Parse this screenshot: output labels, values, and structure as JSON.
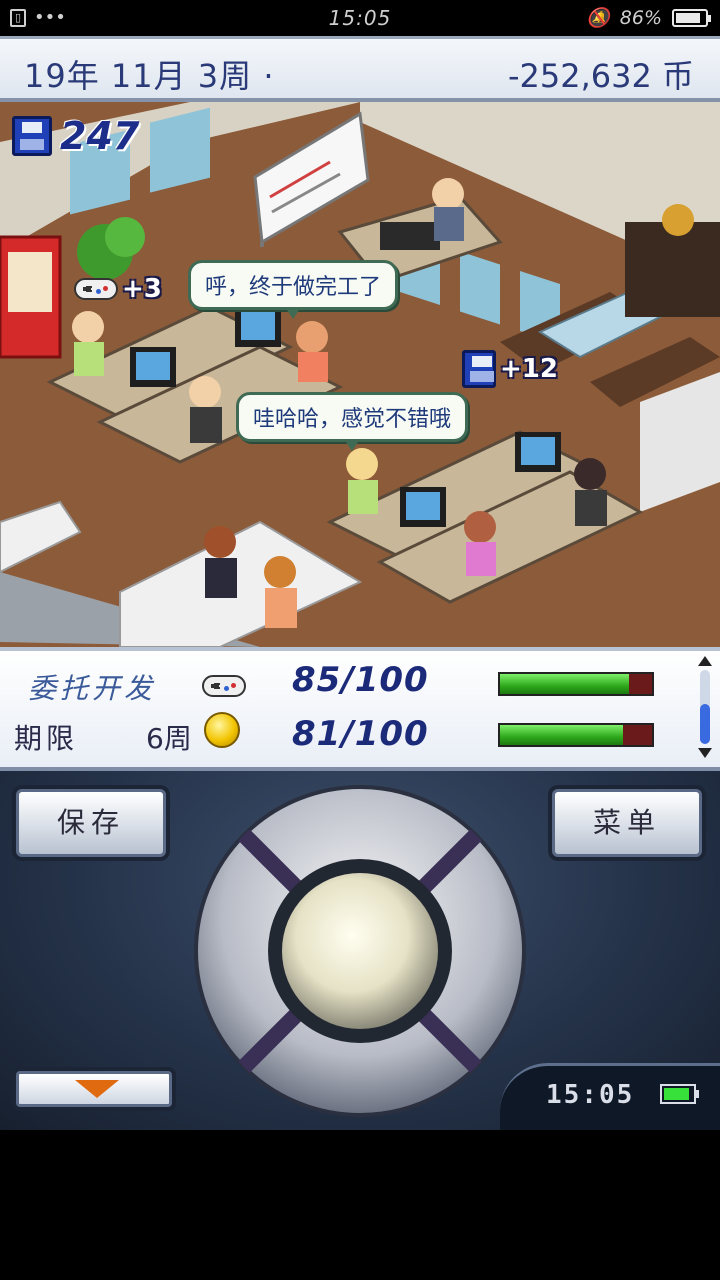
{
  "status_bar": {
    "sim_icon": "sim-card-icon",
    "dots": "•••",
    "time": "15:05",
    "mute_icon": "bell-muted-icon",
    "battery_text": "86%",
    "battery_level": 0.86
  },
  "header": {
    "date": "19年 11月 3周 ·",
    "money": "-252,632 币"
  },
  "scene": {
    "dev_points": "247",
    "speech_1": "呼，终于做完工了",
    "speech_2": "哇哈哈，感觉不错哦",
    "popup_fun": "+3",
    "popup_dev": "+12"
  },
  "project": {
    "name": "委托开发",
    "deadline_label": "期限",
    "deadline_value": "6周",
    "score_1": "85/100",
    "score_2": "81/100",
    "bar_1": 0.85,
    "bar_2": 0.81
  },
  "controls": {
    "save_label": "保存",
    "menu_label": "菜单",
    "clock_time": "15:05",
    "clock_battery": 0.9
  },
  "colors": {
    "text_blue": "#2a3a78",
    "bar_green": "#2ea81c",
    "arrow_orange": "#e06a10"
  }
}
